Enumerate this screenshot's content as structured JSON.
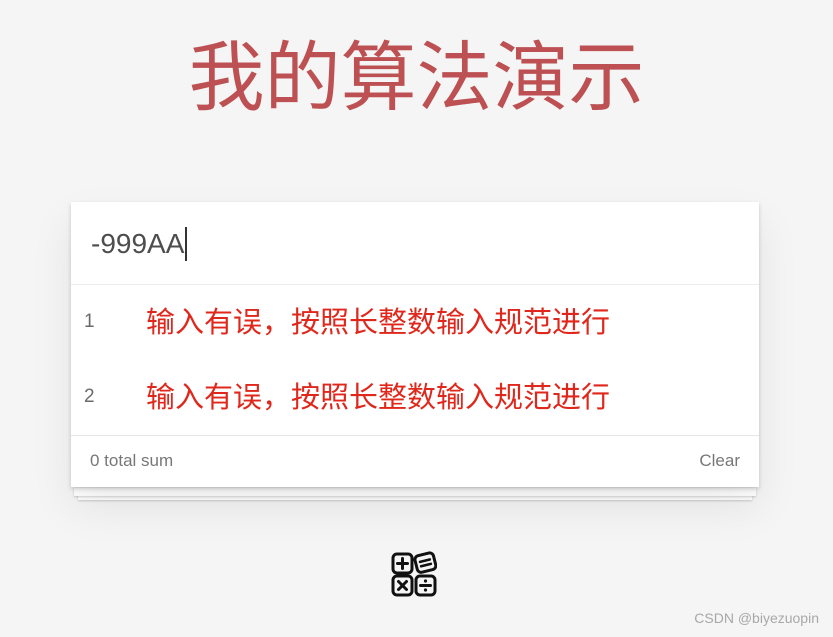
{
  "header": {
    "title": "我的算法演示"
  },
  "input": {
    "value": "-999AA"
  },
  "results": {
    "items": [
      {
        "index": "1",
        "text": "输入有误，按照长整数输入规范进行"
      },
      {
        "index": "2",
        "text": "输入有误，按照长整数输入规范进行"
      }
    ]
  },
  "footer": {
    "count_label": "0 total sum",
    "clear_label": "Clear"
  },
  "icons": {
    "calculator": "calculator-icon"
  },
  "watermark": {
    "text": "CSDN @biyezuopin"
  },
  "colors": {
    "title": "#b83f41",
    "error_text": "#e0271b",
    "background": "#f5f5f5"
  }
}
